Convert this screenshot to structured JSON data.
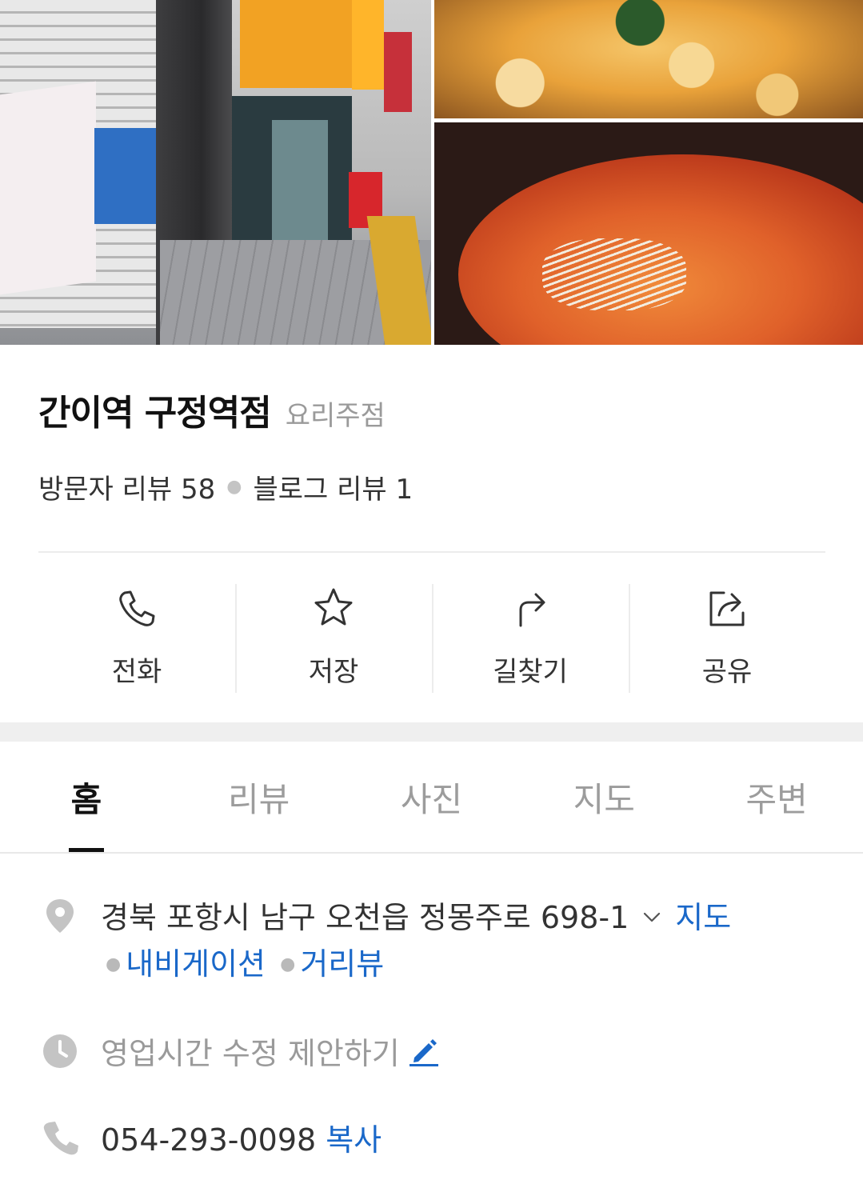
{
  "place": {
    "name": "간이역 구정역점",
    "category": "요리주점",
    "visitor_reviews_label": "방문자 리뷰 58",
    "blog_reviews_label": "블로그 리뷰 1"
  },
  "actions": [
    {
      "label": "전화",
      "icon": "phone-icon"
    },
    {
      "label": "저장",
      "icon": "star-icon"
    },
    {
      "label": "길찾기",
      "icon": "directions-icon"
    },
    {
      "label": "공유",
      "icon": "share-icon"
    }
  ],
  "tabs": [
    {
      "label": "홈",
      "active": true
    },
    {
      "label": "리뷰",
      "active": false
    },
    {
      "label": "사진",
      "active": false
    },
    {
      "label": "지도",
      "active": false
    },
    {
      "label": "주변",
      "active": false
    }
  ],
  "info": {
    "address": "경북 포항시 남구 오천읍 정몽주로 698-1",
    "map_link": "지도",
    "navigation_link": "내비게이션",
    "streetview_link": "거리뷰",
    "hours_text": "영업시간 수정 제안하기",
    "phone": "054-293-0098",
    "copy_label": "복사"
  },
  "colors": {
    "link": "#1a68c9",
    "text_primary": "#111111",
    "text_muted": "#9a9a9a",
    "icon_gray": "#c4c4c4"
  }
}
